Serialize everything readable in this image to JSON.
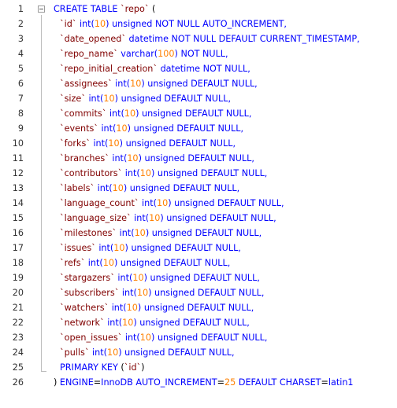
{
  "editor": {
    "lines": [
      {
        "n": "1",
        "tokens": [
          [
            "kw",
            "CREATE TABLE "
          ],
          [
            "ident",
            "`repo`"
          ],
          [
            "op",
            " ("
          ]
        ]
      },
      {
        "n": "2",
        "tokens": [
          [
            "ident",
            "`id`"
          ],
          [
            "op",
            " "
          ],
          [
            "typ",
            "int("
          ],
          [
            "num",
            "10"
          ],
          [
            "typ",
            ") unsigned NOT NULL AUTO_INCREMENT,"
          ]
        ]
      },
      {
        "n": "3",
        "tokens": [
          [
            "ident",
            "`date_opened`"
          ],
          [
            "op",
            " "
          ],
          [
            "typ",
            "datetime NOT NULL DEFAULT CURRENT_TIMESTAMP,"
          ]
        ]
      },
      {
        "n": "4",
        "tokens": [
          [
            "ident",
            "`repo_name`"
          ],
          [
            "op",
            " "
          ],
          [
            "typ",
            "varchar("
          ],
          [
            "num",
            "100"
          ],
          [
            "typ",
            ") NOT NULL,"
          ]
        ]
      },
      {
        "n": "5",
        "tokens": [
          [
            "ident",
            "`repo_initial_creation`"
          ],
          [
            "op",
            " "
          ],
          [
            "typ",
            "datetime NOT NULL,"
          ]
        ]
      },
      {
        "n": "6",
        "tokens": [
          [
            "ident",
            "`assignees`"
          ],
          [
            "op",
            " "
          ],
          [
            "typ",
            "int("
          ],
          [
            "num",
            "10"
          ],
          [
            "typ",
            ") unsigned DEFAULT NULL,"
          ]
        ]
      },
      {
        "n": "7",
        "tokens": [
          [
            "ident",
            "`size`"
          ],
          [
            "op",
            " "
          ],
          [
            "typ",
            "int("
          ],
          [
            "num",
            "10"
          ],
          [
            "typ",
            ") unsigned DEFAULT NULL,"
          ]
        ]
      },
      {
        "n": "8",
        "tokens": [
          [
            "ident",
            "`commits`"
          ],
          [
            "op",
            " "
          ],
          [
            "typ",
            "int("
          ],
          [
            "num",
            "10"
          ],
          [
            "typ",
            ") unsigned DEFAULT NULL,"
          ]
        ]
      },
      {
        "n": "9",
        "tokens": [
          [
            "ident",
            "`events`"
          ],
          [
            "op",
            " "
          ],
          [
            "typ",
            "int("
          ],
          [
            "num",
            "10"
          ],
          [
            "typ",
            ") unsigned DEFAULT NULL,"
          ]
        ]
      },
      {
        "n": "10",
        "tokens": [
          [
            "ident",
            "`forks`"
          ],
          [
            "op",
            " "
          ],
          [
            "typ",
            "int("
          ],
          [
            "num",
            "10"
          ],
          [
            "typ",
            ") unsigned DEFAULT NULL,"
          ]
        ]
      },
      {
        "n": "11",
        "tokens": [
          [
            "ident",
            "`branches`"
          ],
          [
            "op",
            " "
          ],
          [
            "typ",
            "int("
          ],
          [
            "num",
            "10"
          ],
          [
            "typ",
            ") unsigned DEFAULT NULL,"
          ]
        ]
      },
      {
        "n": "12",
        "tokens": [
          [
            "ident",
            "`contributors`"
          ],
          [
            "op",
            " "
          ],
          [
            "typ",
            "int("
          ],
          [
            "num",
            "10"
          ],
          [
            "typ",
            ") unsigned DEFAULT NULL,"
          ]
        ]
      },
      {
        "n": "13",
        "tokens": [
          [
            "ident",
            "`labels`"
          ],
          [
            "op",
            " "
          ],
          [
            "typ",
            "int("
          ],
          [
            "num",
            "10"
          ],
          [
            "typ",
            ") unsigned DEFAULT NULL,"
          ]
        ]
      },
      {
        "n": "14",
        "tokens": [
          [
            "ident",
            "`language_count`"
          ],
          [
            "op",
            " "
          ],
          [
            "typ",
            "int("
          ],
          [
            "num",
            "10"
          ],
          [
            "typ",
            ") unsigned DEFAULT NULL,"
          ]
        ]
      },
      {
        "n": "15",
        "tokens": [
          [
            "ident",
            "`language_size`"
          ],
          [
            "op",
            " "
          ],
          [
            "typ",
            "int("
          ],
          [
            "num",
            "10"
          ],
          [
            "typ",
            ") unsigned DEFAULT NULL,"
          ]
        ]
      },
      {
        "n": "16",
        "tokens": [
          [
            "ident",
            "`milestones`"
          ],
          [
            "op",
            " "
          ],
          [
            "typ",
            "int("
          ],
          [
            "num",
            "10"
          ],
          [
            "typ",
            ") unsigned DEFAULT NULL,"
          ]
        ]
      },
      {
        "n": "17",
        "tokens": [
          [
            "ident",
            "`issues`"
          ],
          [
            "op",
            " "
          ],
          [
            "typ",
            "int("
          ],
          [
            "num",
            "10"
          ],
          [
            "typ",
            ") unsigned DEFAULT NULL,"
          ]
        ]
      },
      {
        "n": "18",
        "tokens": [
          [
            "ident",
            "`refs`"
          ],
          [
            "op",
            " "
          ],
          [
            "typ",
            "int("
          ],
          [
            "num",
            "10"
          ],
          [
            "typ",
            ") unsigned DEFAULT NULL,"
          ]
        ]
      },
      {
        "n": "19",
        "tokens": [
          [
            "ident",
            "`stargazers`"
          ],
          [
            "op",
            " "
          ],
          [
            "typ",
            "int("
          ],
          [
            "num",
            "10"
          ],
          [
            "typ",
            ") unsigned DEFAULT NULL,"
          ]
        ]
      },
      {
        "n": "20",
        "tokens": [
          [
            "ident",
            "`subscribers`"
          ],
          [
            "op",
            " "
          ],
          [
            "typ",
            "int("
          ],
          [
            "num",
            "10"
          ],
          [
            "typ",
            ") unsigned DEFAULT NULL,"
          ]
        ]
      },
      {
        "n": "21",
        "tokens": [
          [
            "ident",
            "`watchers`"
          ],
          [
            "op",
            " "
          ],
          [
            "typ",
            "int("
          ],
          [
            "num",
            "10"
          ],
          [
            "typ",
            ") unsigned DEFAULT NULL,"
          ]
        ]
      },
      {
        "n": "22",
        "tokens": [
          [
            "ident",
            "`network`"
          ],
          [
            "op",
            " "
          ],
          [
            "typ",
            "int("
          ],
          [
            "num",
            "10"
          ],
          [
            "typ",
            ") unsigned DEFAULT NULL,"
          ]
        ]
      },
      {
        "n": "23",
        "tokens": [
          [
            "ident",
            "`open_issues`"
          ],
          [
            "op",
            " "
          ],
          [
            "typ",
            "int("
          ],
          [
            "num",
            "10"
          ],
          [
            "typ",
            ") unsigned DEFAULT NULL,"
          ]
        ]
      },
      {
        "n": "24",
        "tokens": [
          [
            "ident",
            "`pulls`"
          ],
          [
            "op",
            " "
          ],
          [
            "typ",
            "int("
          ],
          [
            "num",
            "10"
          ],
          [
            "typ",
            ") unsigned DEFAULT NULL,"
          ]
        ]
      },
      {
        "n": "25",
        "tokens": [
          [
            "kw",
            "PRIMARY KEY "
          ],
          [
            "op",
            "("
          ],
          [
            "ident",
            "`id`"
          ],
          [
            "op",
            ")"
          ]
        ]
      },
      {
        "n": "26",
        "tokens": [
          [
            "op",
            ") "
          ],
          [
            "kw",
            "ENGINE"
          ],
          [
            "op",
            "="
          ],
          [
            "typ",
            "InnoDB "
          ],
          [
            "kw",
            "AUTO_INCREMENT"
          ],
          [
            "op",
            "="
          ],
          [
            "num",
            "25"
          ],
          [
            "op",
            " "
          ],
          [
            "kw",
            "DEFAULT CHARSET"
          ],
          [
            "op",
            "="
          ],
          [
            "typ",
            "latin1"
          ]
        ]
      }
    ]
  },
  "colors": {
    "keyword": "#0000ff",
    "identifier": "#800000",
    "number": "#ff8000",
    "line_number": "#333333"
  }
}
